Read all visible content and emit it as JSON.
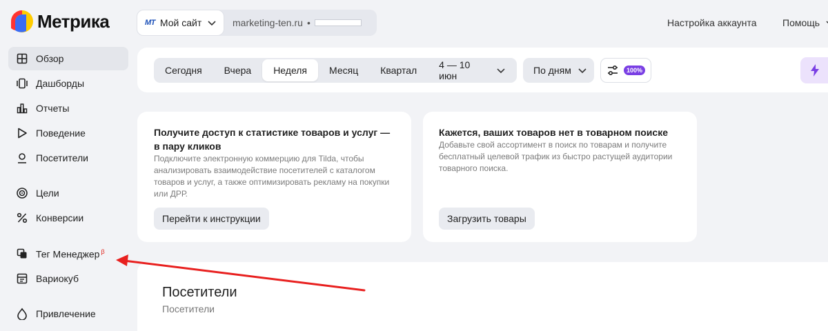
{
  "app": {
    "logo_text": "Метрика"
  },
  "header": {
    "site_badge": "МТ",
    "site_name": "Мой сайт",
    "site_url": "marketing-ten.ru",
    "site_separator": "•",
    "account_label": "Настройка аккаунта",
    "help_label": "Помощь"
  },
  "sidebar": {
    "items": [
      {
        "label": "Обзор",
        "icon": "grid-icon",
        "active": true
      },
      {
        "label": "Дашборды",
        "icon": "dashboards-icon"
      },
      {
        "label": "Отчеты",
        "icon": "bar-chart-icon"
      },
      {
        "label": "Поведение",
        "icon": "play-icon"
      },
      {
        "label": "Посетители",
        "icon": "person-icon"
      },
      {
        "label": "Цели",
        "icon": "target-icon"
      },
      {
        "label": "Конверсии",
        "icon": "percent-icon"
      },
      {
        "label": "Тег Менеджер",
        "icon": "tag-manager-icon",
        "badge": "β"
      },
      {
        "label": "Вариокуб",
        "icon": "variocube-icon"
      },
      {
        "label": "Привлечение",
        "icon": "acquisition-icon"
      }
    ]
  },
  "filters": {
    "periods": [
      "Сегодня",
      "Вчера",
      "Неделя",
      "Месяц",
      "Квартал"
    ],
    "active_period": "Неделя",
    "date_range": "4 — 10 июн",
    "grouping": "По дням",
    "sampling_badge": "100%"
  },
  "cards": [
    {
      "title": "Получите доступ к статистике товаров и услуг — в пару кликов",
      "description": "Подключите электронную коммерцию для Tilda, чтобы анализировать взаимодействие посетителей с каталогом товаров и услуг, а также оптимизировать рекламу на покупки или ДРР.",
      "button": "Перейти к инструкции"
    },
    {
      "title": "Кажется, ваших товаров нет в товарном поиске",
      "description": "Добавьте свой ассортимент в поиск по товарам и получите бесплатный целевой трафик из быстро растущей аудитории товарного поиска.",
      "button": "Загрузить товары"
    }
  ],
  "visitors": {
    "title": "Посетители",
    "subtitle": "Посетители"
  },
  "colors": {
    "accent_purple": "#7a3fe4",
    "annotation_red": "#e8201f",
    "active_nav_bg": "#e4e6eb"
  }
}
